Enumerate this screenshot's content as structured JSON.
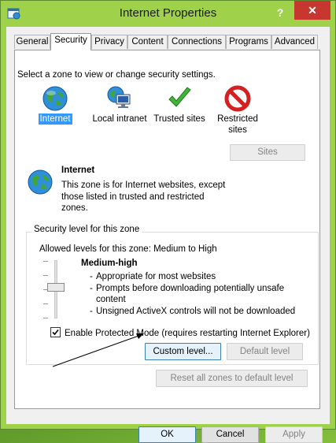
{
  "window": {
    "title": "Internet Properties",
    "help_label": "?",
    "close_label": "✕"
  },
  "tabs": [
    {
      "label": "General"
    },
    {
      "label": "Security"
    },
    {
      "label": "Privacy"
    },
    {
      "label": "Content"
    },
    {
      "label": "Connections"
    },
    {
      "label": "Programs"
    },
    {
      "label": "Advanced"
    }
  ],
  "select_zone_text": "Select a zone to view or change security settings.",
  "zones": [
    {
      "label": "Internet",
      "icon": "globe-icon"
    },
    {
      "label": "Local intranet",
      "icon": "computer-globe-icon"
    },
    {
      "label": "Trusted sites",
      "icon": "checkmark-icon"
    },
    {
      "label": "Restricted sites",
      "icon": "no-entry-icon"
    }
  ],
  "zone_info": {
    "title": "Internet",
    "description": "This zone is for Internet websites, except those listed in trusted and restricted zones."
  },
  "sites_button": "Sites",
  "security_level": {
    "group_label": "Security level for this zone",
    "allowed_levels": "Allowed levels for this zone: Medium to High",
    "level_name": "Medium-high",
    "bullets": [
      "Appropriate for most websites",
      "Prompts before downloading potentially unsafe content",
      "Unsigned ActiveX controls will not be downloaded"
    ],
    "protected_mode_label": "Enable Protected Mode (requires restarting Internet Explorer)",
    "protected_mode_checked": true,
    "custom_level_button": "Custom level...",
    "default_level_button": "Default level"
  },
  "reset_all_button": "Reset all zones to default level",
  "footer": {
    "ok": "OK",
    "cancel": "Cancel",
    "apply": "Apply"
  },
  "colors": {
    "selection": "#3399ff",
    "close": "#c7372f",
    "focus_border": "#3c7fb1"
  }
}
